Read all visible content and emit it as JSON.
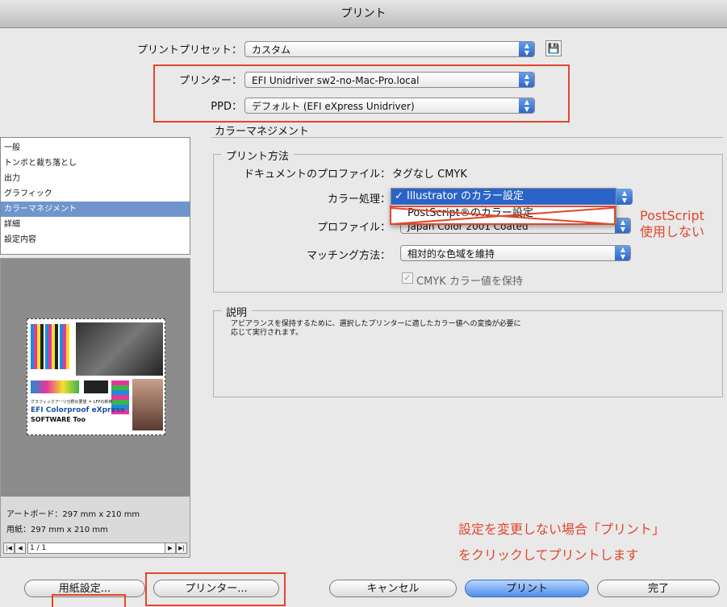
{
  "window": {
    "title": "プリント"
  },
  "preset": {
    "label": "プリントプリセット：",
    "value": "カスタム",
    "save_icon": "💾"
  },
  "printer": {
    "label": "プリンター：",
    "value": "EFI Unidriver sw2-no-Mac-Pro.local"
  },
  "ppd": {
    "label": "PPD：",
    "value": "デフォルト (EFI eXpress Unidriver)"
  },
  "section_title": "カラーマネジメント",
  "sidebar": {
    "items": [
      {
        "label": "一般"
      },
      {
        "label": "トンボと裁ち落とし"
      },
      {
        "label": "出力"
      },
      {
        "label": "グラフィック"
      },
      {
        "label": "カラーマネジメント"
      },
      {
        "label": "詳細"
      },
      {
        "label": "設定内容"
      }
    ],
    "selected_index": 4
  },
  "preview": {
    "artboard": "アートボード：297 mm x 210 mm",
    "paper": "用紙：297 mm x 210 mm",
    "page": "1 / 1",
    "text1": "グラフィックアーツ分野の要望 ＊ LFPの新参",
    "text2": "EFI Colorproof eXpress",
    "text3": "SOFTWARE Too"
  },
  "print_method": {
    "title": "プリント方法",
    "doc_profile_label": "ドキュメントのプロファイル：",
    "doc_profile_value": "タグなし CMYK",
    "color_handling_label": "カラー処理：",
    "profile_label": "プロファイル：",
    "profile_value": "Japan Color 2001 Coated",
    "matching_label": "マッチング方法：",
    "matching_value": "相対的な色域を維持",
    "cmyk_checkbox_label": "CMYK カラー値を保持",
    "cmyk_checked": true,
    "dropdown_items": [
      {
        "label": "✓ Illustrator のカラー設定"
      },
      {
        "label": "PostScript®のカラー設定"
      }
    ]
  },
  "annotation": {
    "postscript_note_1": "PostScript",
    "postscript_note_2": "使用しない",
    "footer_note_1": "設定を変更しない場合「プリント」",
    "footer_note_2": "をクリックしてプリントします"
  },
  "description": {
    "title": "説明",
    "text_1": "アピアランスを保持するために、選択したプリンターに適したカラー値への変換が必要に",
    "text_2": "応じて実行されます。"
  },
  "buttons": {
    "page_setup": "用紙設定...",
    "printer": "プリンター...",
    "cancel": "キャンセル",
    "print": "プリント",
    "done": "完了"
  },
  "colors": {
    "annotation_red": "#e2462b",
    "selection_blue": "#2a64c8"
  }
}
